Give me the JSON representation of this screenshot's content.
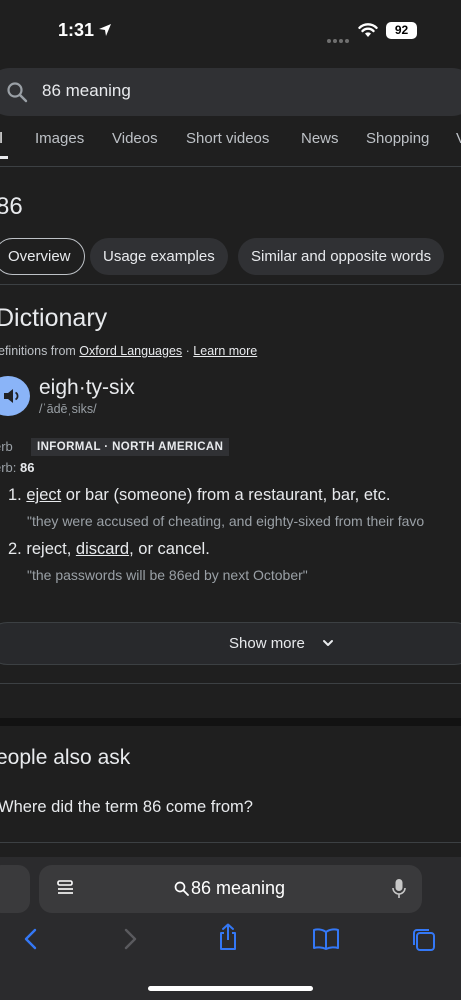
{
  "status": {
    "time": "1:31",
    "battery": "92"
  },
  "search": {
    "query": "86 meaning"
  },
  "tabs": [
    "ll",
    "Images",
    "Videos",
    "Short videos",
    "News",
    "Shopping",
    "V"
  ],
  "result_title": "86",
  "chips": [
    "Overview",
    "Usage examples",
    "Similar and opposite words"
  ],
  "dictionary": {
    "heading": "Dictionary",
    "defs_prefix": "efinitions from",
    "source": "Oxford Languages",
    "sep": "·",
    "learn_more": "Learn more",
    "word": "eigh·ty-six",
    "phonetic": "/ˈādēˌsiks/",
    "pos": "erb",
    "label": "INFORMAL · NORTH AMERICAN",
    "verb_label": "erb:",
    "verb_value": "86",
    "definitions": [
      {
        "num": "1.",
        "link": "eject",
        "rest": " or bar (someone) from a restaurant, bar, etc.",
        "example": "\"they were accused of cheating, and eighty-sixed from their favo"
      },
      {
        "num": "2.",
        "pre": "reject, ",
        "link": "discard",
        "rest": ", or cancel.",
        "example": "\"the passwords will be 86ed by next October\""
      }
    ],
    "show_more": "Show more"
  },
  "people_also_ask": {
    "heading": "eople also ask",
    "questions": [
      "Where did the term 86 come from?"
    ]
  },
  "safari": {
    "address": "86 meaning"
  }
}
